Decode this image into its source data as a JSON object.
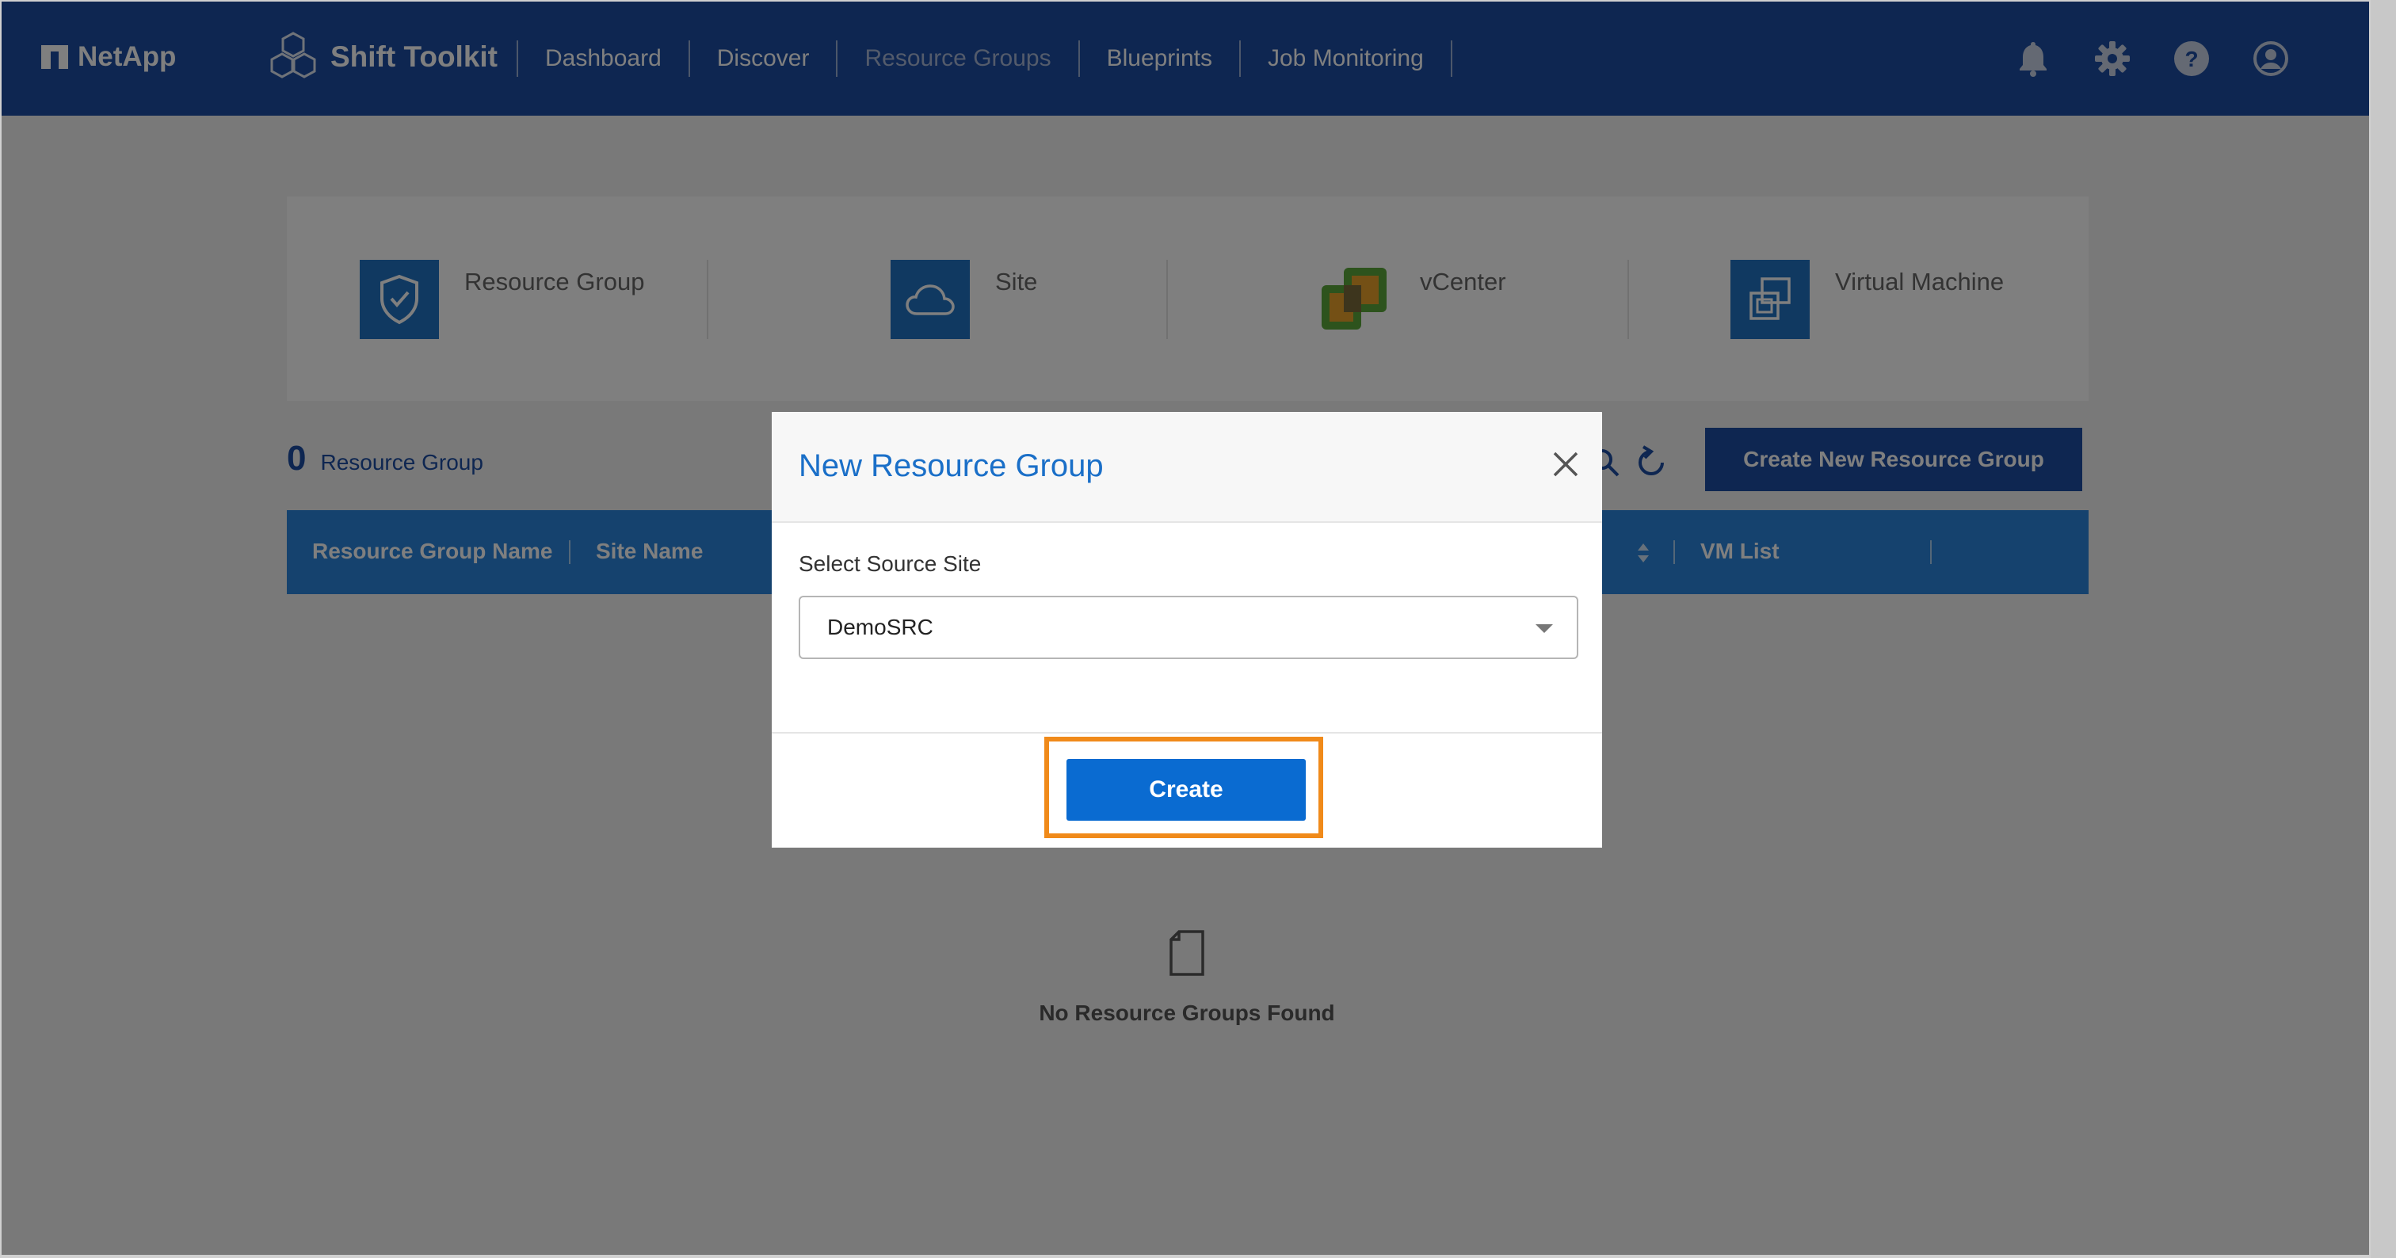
{
  "header": {
    "brand": "NetApp",
    "product": "Shift Toolkit",
    "nav": [
      {
        "label": "Dashboard",
        "active": false
      },
      {
        "label": "Discover",
        "active": false
      },
      {
        "label": "Resource Groups",
        "active": true
      },
      {
        "label": "Blueprints",
        "active": false
      },
      {
        "label": "Job Monitoring",
        "active": false
      }
    ],
    "icons": [
      "bell-icon",
      "gear-icon",
      "help-icon",
      "user-icon"
    ]
  },
  "summary": {
    "items": [
      {
        "label": "Resource Group",
        "icon": "shield-check-icon"
      },
      {
        "label": "Site",
        "icon": "cloud-icon"
      },
      {
        "label": "vCenter",
        "icon": "vcenter-icon"
      },
      {
        "label": "Virtual Machine",
        "icon": "virtual-machine-icon"
      }
    ]
  },
  "list": {
    "count": "0",
    "count_label": "Resource Group",
    "create_button": "Create New Resource Group",
    "columns": [
      "Resource Group Name",
      "Site Name",
      "VM List"
    ],
    "empty_text": "No Resource Groups Found"
  },
  "modal": {
    "title": "New Resource Group",
    "field_label": "Select Source Site",
    "selected_site": "DemoSRC",
    "create_button": "Create"
  },
  "colors": {
    "nav_bg": "#1d4da3",
    "accent_blue": "#2a84dc",
    "modal_title": "#1a6fc8",
    "highlight": "#f08a1a"
  }
}
